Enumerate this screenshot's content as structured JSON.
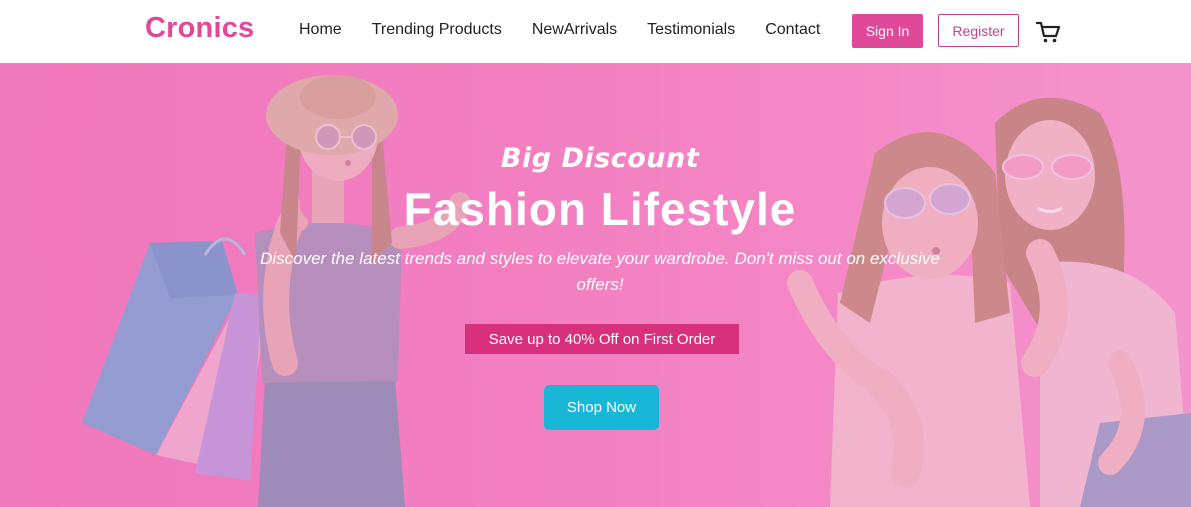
{
  "brand": {
    "logo_text": "Cronics",
    "accent_color": "#e0489a"
  },
  "nav": {
    "links": [
      {
        "label": "Home"
      },
      {
        "label": "Trending Products"
      },
      {
        "label": "NewArrivals"
      },
      {
        "label": "Testimonials"
      },
      {
        "label": "Contact"
      }
    ],
    "signin_label": "Sign In",
    "register_label": "Register",
    "cart_icon": "cart-icon"
  },
  "hero": {
    "subtitle": "Big Discount",
    "title": "Fashion Lifestyle",
    "description": "Discover the latest trends and styles to elevate your wardrobe. Don't miss out on exclusive offers!",
    "promo_text": "Save up to 40% Off on First Order",
    "cta_label": "Shop Now",
    "background_color": "#f47fc0",
    "promo_color": "#d8307c",
    "cta_color": "#18b7d8"
  }
}
